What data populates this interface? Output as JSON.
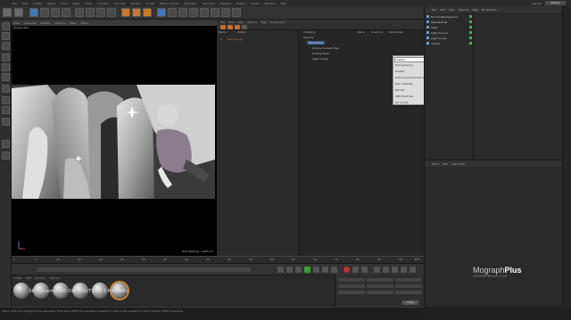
{
  "app": {
    "menu": [
      "File",
      "Edit",
      "Create",
      "Select",
      "Tools",
      "Mesh",
      "Snap",
      "Animate",
      "Simulate",
      "Render",
      "Sculpt",
      "Motion Tracker",
      "MoGraph",
      "Character",
      "Pipeline",
      "Plugins",
      "Script",
      "Window",
      "Help"
    ],
    "layout_label": "Layout:",
    "layout_value": "Startup"
  },
  "viewport": {
    "menu": [
      "View",
      "Cameras",
      "Display",
      "Options",
      "Filter",
      "Panel"
    ],
    "label": "Perspective",
    "status": "Grid Spacing : 1000 cm"
  },
  "timeline": {
    "ticks": [
      "0",
      "5",
      "10",
      "15",
      "20",
      "25",
      "30",
      "35",
      "40",
      "45",
      "50",
      "55",
      "60",
      "65",
      "70",
      "75",
      "80",
      "85",
      "90"
    ],
    "frame": "0 F"
  },
  "materials": {
    "menu": [
      "Create",
      "Edit",
      "Function",
      "Texture"
    ]
  },
  "coords": {
    "apply": "Apply"
  },
  "watermark": "3D Cinema 4D ON YOUTUBE CHANNEL",
  "statusbar": "Move: Click and drag to move elements. Hold down SHIFT to quantize movement / add to the selection in point mode, CTRL to remove.",
  "visual_group": {
    "tabs": [
      "File",
      "Edit",
      "View",
      "Objects",
      "Tags",
      "Bookmarks"
    ],
    "list_headers": [
      "Name",
      "Visible"
    ],
    "list_item": "Item Group",
    "category_headers": [
      "Category",
      "Value",
      "Override",
      "Global Key"
    ],
    "categories": [
      "Objects",
      "Text Group",
      "Octane Camera Tag",
      "Editing Mask",
      "Light Group"
    ]
  },
  "dropdown": {
    "items": [
      "Visible",
      "Transparency",
      "Display",
      "Deformer/Generators",
      "Hair Visibility",
      "Render",
      "XBD Particles",
      "XG Cache"
    ]
  },
  "object_manager": {
    "menu": [
      "File",
      "Edit",
      "View",
      "Objects",
      "Tags",
      "Bookmarks"
    ],
    "items": [
      "DrCircleBackground",
      "MainTextObj",
      "Texts",
      "Light Source",
      "Light Group",
      "cam01"
    ]
  },
  "attributes": {
    "menu": [
      "Mode",
      "Edit",
      "User Data"
    ]
  },
  "brand": {
    "name_light": "Mograph",
    "name_bold": "Plus",
    "url": "MOGRAPHPLUS.COM"
  },
  "colors": {
    "accent_orange": "#c9792a",
    "selection_blue": "#3d5f8c",
    "play_green": "#3c9d3c"
  }
}
